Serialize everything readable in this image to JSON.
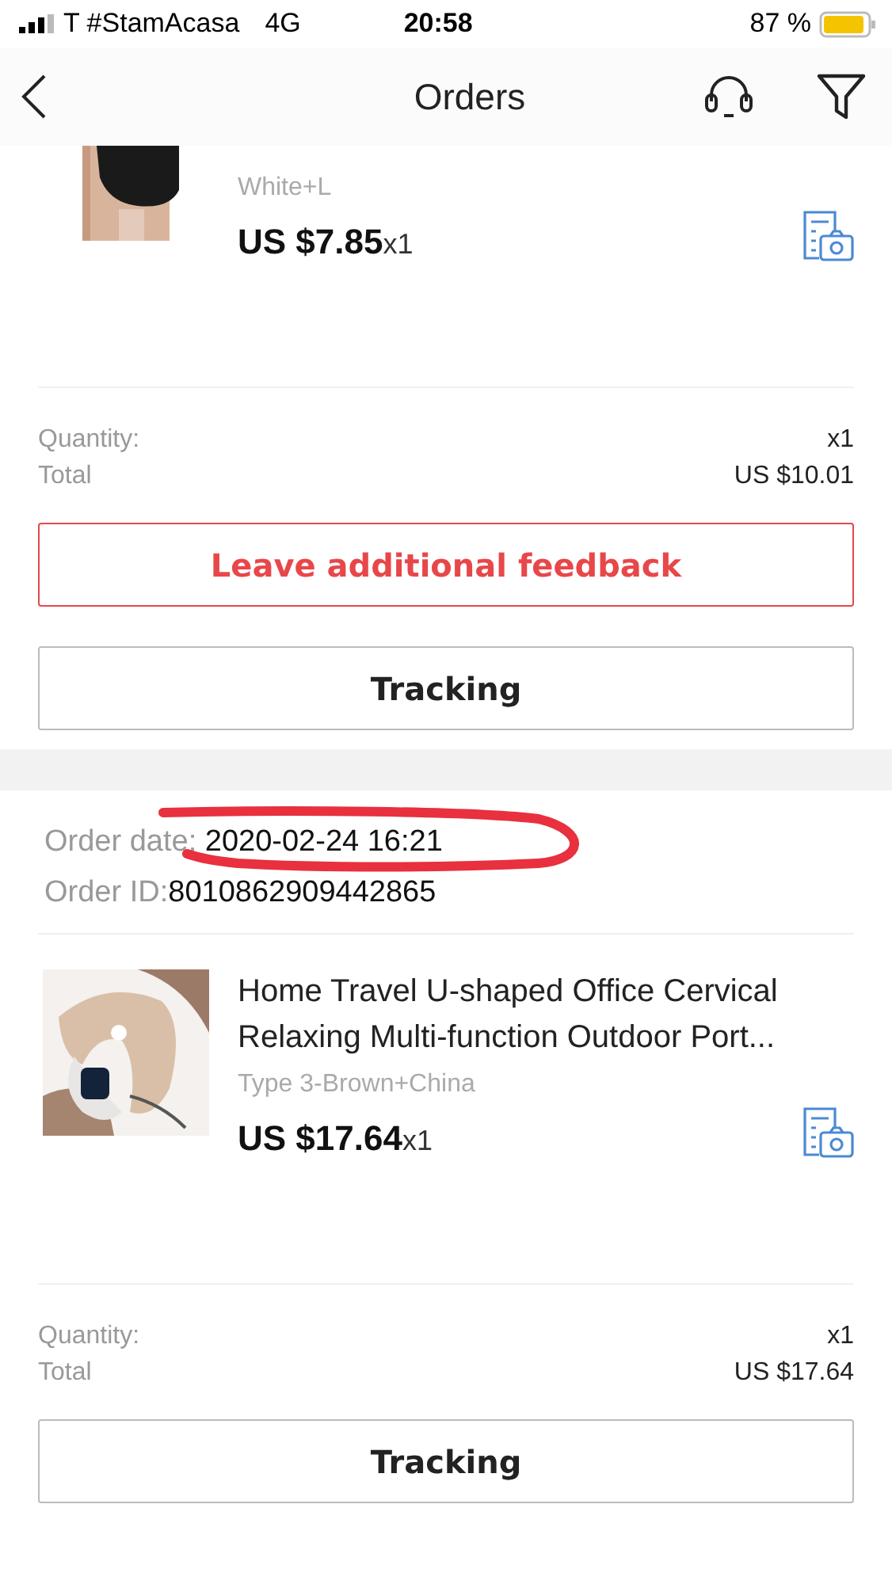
{
  "status_bar": {
    "carrier": "T #StamAcasa",
    "network": "4G",
    "time": "20:58",
    "battery": "87 %"
  },
  "header": {
    "title": "Orders"
  },
  "orders": [
    {
      "item": {
        "variant": "White+L",
        "price": "US $7.85",
        "qty": "x1"
      },
      "quantity_label": "Quantity:",
      "quantity": "x1",
      "total_label": "Total",
      "total": "US $10.01",
      "buttons": [
        {
          "label": "Leave additional feedback",
          "kind": "feedback"
        },
        {
          "label": "Tracking",
          "kind": "plain"
        }
      ]
    },
    {
      "date_label": "Order date:",
      "date": "2020-02-24 16:21",
      "id_label": "Order ID:",
      "id": "8010862909442865",
      "item": {
        "title": "Home Travel U-shaped Office Cervical Relaxing Multi-function Outdoor Port...",
        "variant": "Type 3-Brown+China",
        "price": "US $17.64",
        "qty": "x1"
      },
      "quantity_label": "Quantity:",
      "quantity": "x1",
      "total_label": "Total",
      "total": "US $17.64",
      "buttons": [
        {
          "label": "Tracking",
          "kind": "plain"
        }
      ]
    }
  ]
}
